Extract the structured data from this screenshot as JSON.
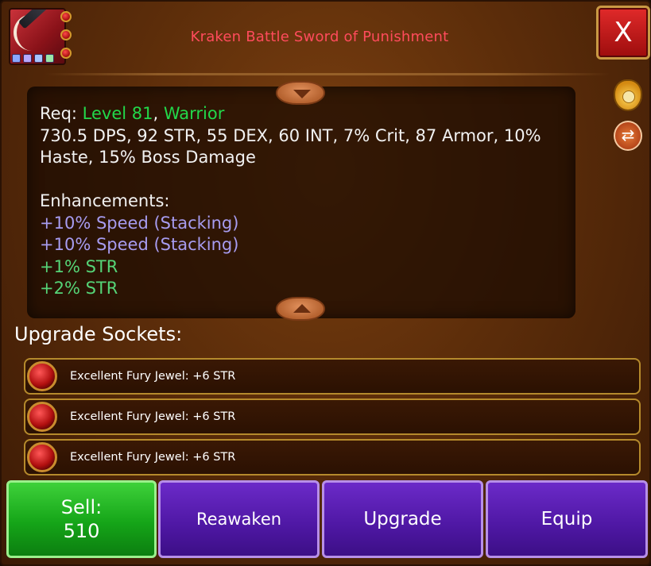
{
  "header": {
    "item_title": "Kraken Battle Sword of Punishment",
    "close_label": "X"
  },
  "item_icon": {
    "socket_count": 3,
    "gem_pip_colors": [
      "#8aa7ff",
      "#b7a8ff",
      "#a7c4ff",
      "#9ae6a8"
    ]
  },
  "description": {
    "req_prefix": "Req: ",
    "req_level": "Level 81",
    "req_sep": ", ",
    "req_class": "Warrior",
    "stats": "730.5 DPS, 92 STR, 55 DEX, 60 INT, 7% Crit, 87 Armor, 10% Haste, 15% Boss Damage",
    "enhancements_heading": "Enhancements:",
    "enhancements": [
      {
        "text": "+10% Speed (Stacking)",
        "color": "#a79cf0"
      },
      {
        "text": "+10% Speed (Stacking)",
        "color": "#a79cf0"
      },
      {
        "text": "+1% STR",
        "color": "#55d477"
      },
      {
        "text": "+2% STR",
        "color": "#55d477"
      }
    ]
  },
  "side_icons": [
    "money-bag-icon",
    "swap-icon"
  ],
  "upgrade_sockets": {
    "title": "Upgrade Sockets:",
    "items": [
      {
        "label": "Excellent Fury Jewel: +6 STR",
        "gem": "red"
      },
      {
        "label": "Excellent Fury Jewel: +6 STR",
        "gem": "red"
      },
      {
        "label": "Excellent Fury Jewel: +6 STR",
        "gem": "red"
      }
    ]
  },
  "actions": {
    "sell_label": "Sell:",
    "sell_value": "510",
    "reawaken_label": "Reawaken",
    "upgrade_label": "Upgrade",
    "equip_label": "Equip"
  },
  "colors": {
    "title_red": "#ff4b5c",
    "req_green": "#22d84a",
    "sell_green": "#15a518",
    "button_purple": "#4e17a3"
  }
}
